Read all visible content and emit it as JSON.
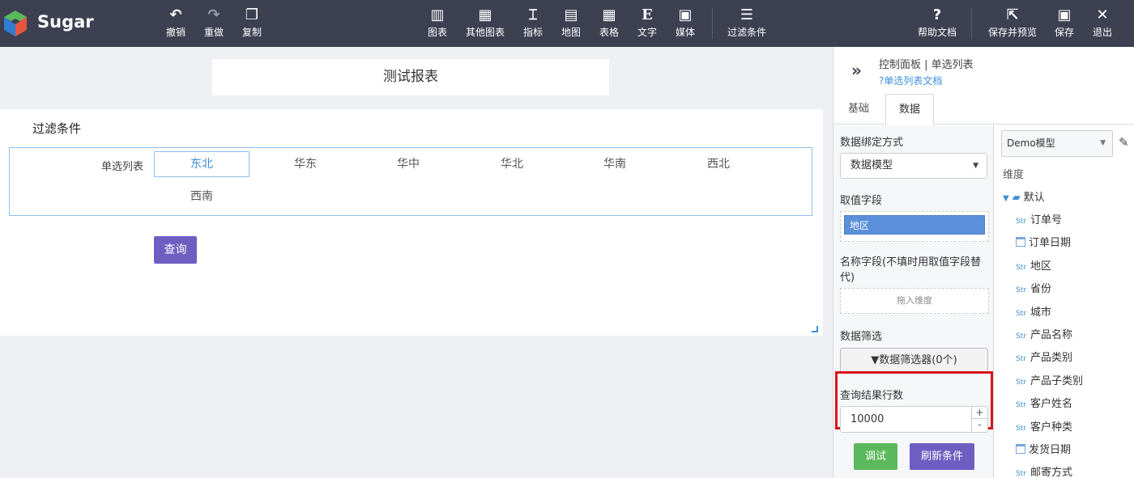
{
  "app": {
    "brand": "Sugar"
  },
  "toolbar": {
    "left": [
      {
        "icon": "undo-icon",
        "glyph": "↶",
        "label": "撤销"
      },
      {
        "icon": "redo-icon",
        "glyph": "↷",
        "label": "重做"
      },
      {
        "icon": "copy-icon",
        "glyph": "❐",
        "label": "复制"
      }
    ],
    "center": [
      {
        "icon": "bar-chart-icon",
        "glyph": "▥",
        "label": "图表"
      },
      {
        "icon": "grid-chart-icon",
        "glyph": "▦",
        "label": "其他图表"
      },
      {
        "icon": "indicator-icon",
        "glyph": "⌶",
        "label": "指标"
      },
      {
        "icon": "map-icon",
        "glyph": "▤",
        "label": "地图"
      },
      {
        "icon": "table-icon",
        "glyph": "▦",
        "label": "表格"
      },
      {
        "icon": "text-icon",
        "glyph": "E",
        "label": "文字"
      },
      {
        "icon": "media-icon",
        "glyph": "▣",
        "label": "媒体"
      },
      {
        "icon": "filter-list-icon",
        "glyph": "☰",
        "label": "过滤条件"
      }
    ],
    "right": [
      {
        "icon": "help-icon",
        "glyph": "?",
        "label": "帮助文档"
      },
      {
        "icon": "save-preview-icon",
        "glyph": "⇱",
        "label": "保存并预览"
      },
      {
        "icon": "save-icon",
        "glyph": "▣",
        "label": "保存"
      },
      {
        "icon": "exit-icon",
        "glyph": "✕",
        "label": "退出"
      }
    ]
  },
  "canvas": {
    "report_title": "测试报表",
    "filter_title": "过滤条件",
    "select_list": {
      "label": "单选列表",
      "options": [
        "东北",
        "华东",
        "华中",
        "华北",
        "华南",
        "西北",
        "西南"
      ],
      "selected": "东北"
    },
    "query_button": "查询"
  },
  "control_panel": {
    "title": "控制面板 | 单选列表",
    "doc_link": "?单选列表文档",
    "tabs": [
      {
        "label": "基础"
      },
      {
        "label": "数据"
      }
    ],
    "active_tab": "数据",
    "binding_label": "数据绑定方式",
    "binding_value": "数据模型",
    "value_field_label": "取值字段",
    "value_field_chip": "地区",
    "name_field_label": "名称字段(不填时用取值字段替代)",
    "name_field_hint": "拖入维度",
    "data_filter_label": "数据筛选",
    "data_filter_button": "数据筛选器(0个)",
    "result_rows_label": "查询结果行数",
    "result_rows_value": "10000",
    "spin_up": "+",
    "spin_down": "-",
    "debug_button": "调试",
    "refresh_button": "刷新条件",
    "model_select": "Demo模型",
    "dimension_label": "维度",
    "folder_label": "默认",
    "fields": [
      {
        "type": "Str",
        "name": "订单号"
      },
      {
        "type": "date",
        "name": "订单日期"
      },
      {
        "type": "Str",
        "name": "地区"
      },
      {
        "type": "Str",
        "name": "省份"
      },
      {
        "type": "Str",
        "name": "城市"
      },
      {
        "type": "Str",
        "name": "产品名称"
      },
      {
        "type": "Str",
        "name": "产品类别"
      },
      {
        "type": "Str",
        "name": "产品子类别"
      },
      {
        "type": "Str",
        "name": "客户姓名"
      },
      {
        "type": "Str",
        "name": "客户种类"
      },
      {
        "type": "date",
        "name": "发货日期"
      },
      {
        "type": "Str",
        "name": "邮寄方式"
      }
    ]
  }
}
